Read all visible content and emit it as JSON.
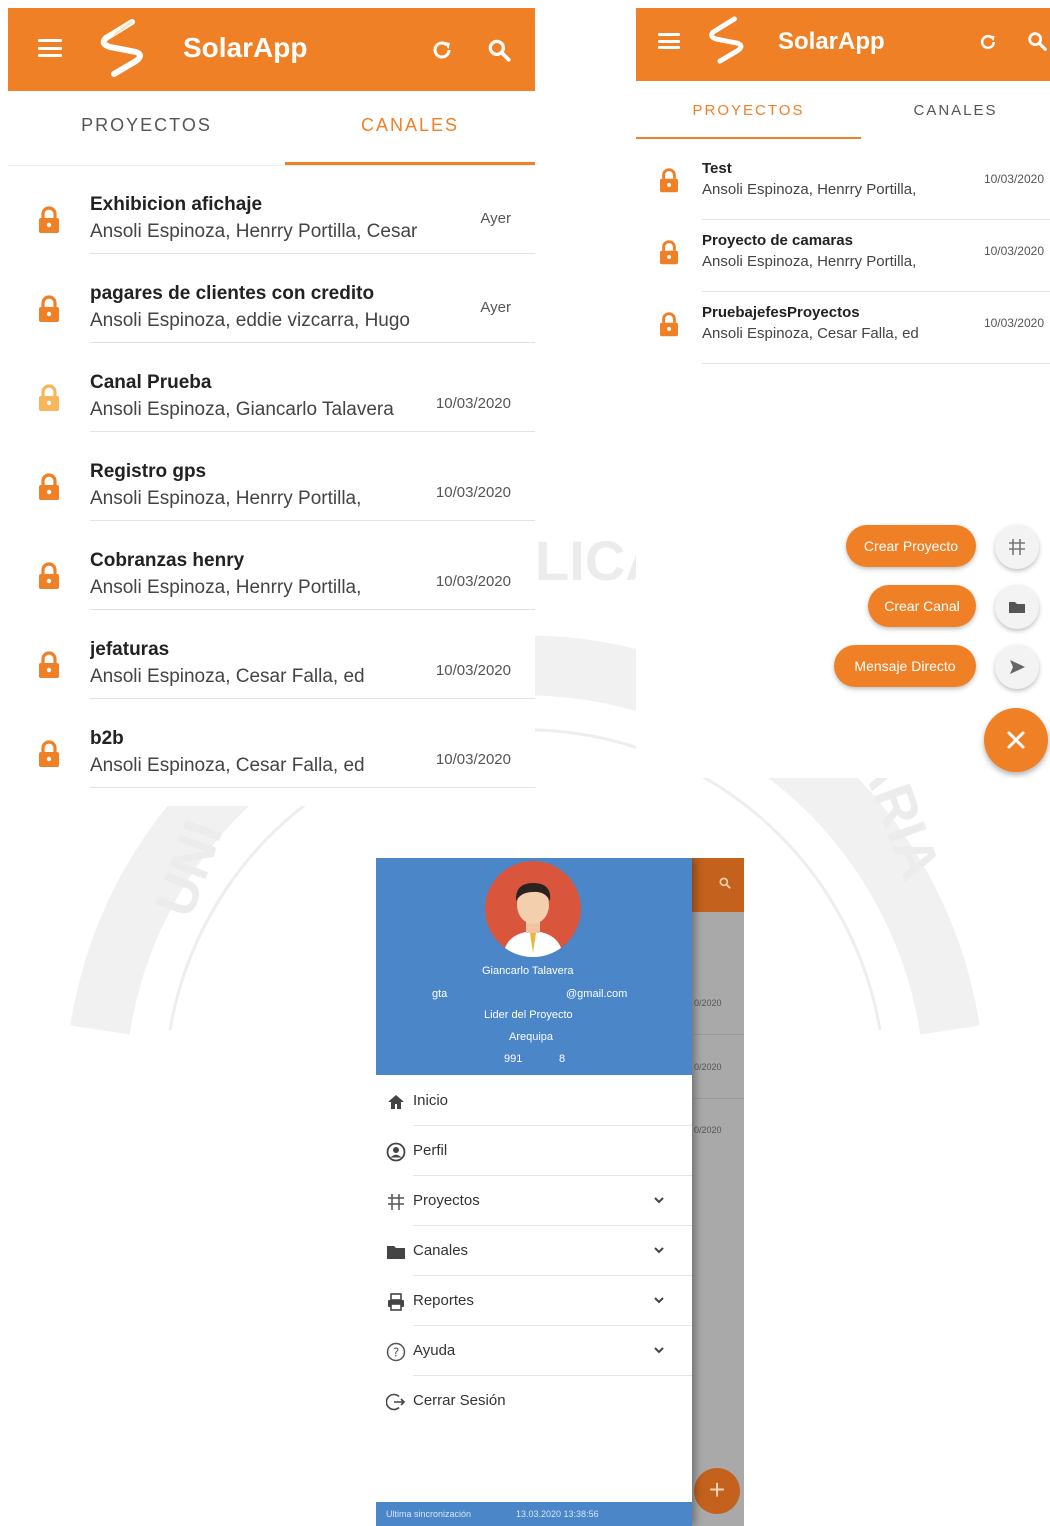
{
  "colors": {
    "primary": "#f08026",
    "lock": "#f08026",
    "lock_light": "#f7b65c",
    "drawer_header": "#4a86c8"
  },
  "app": {
    "title": "SolarApp"
  },
  "tabs": {
    "proyectos": "PROYECTOS",
    "canales": "CANALES"
  },
  "screen1": {
    "active_tab": "CANALES",
    "channels": [
      {
        "title": "Exhibicion afichaje",
        "subtitle": "Ansoli Espinoza, Henrry Portilla, Cesar",
        "date": "Ayer",
        "lock": "lock-icon"
      },
      {
        "title": "pagares de clientes con credito",
        "subtitle": "Ansoli Espinoza, eddie vizcarra, Hugo",
        "date": "Ayer",
        "lock": "lock-icon"
      },
      {
        "title": "Canal Prueba",
        "subtitle": "Ansoli Espinoza, Giancarlo Talavera",
        "date": "10/03/2020",
        "lock": "lock-open-icon"
      },
      {
        "title": "Registro gps",
        "subtitle": "Ansoli Espinoza, Henrry Portilla,",
        "date": "10/03/2020",
        "lock": "lock-icon"
      },
      {
        "title": "Cobranzas henry",
        "subtitle": "Ansoli Espinoza, Henrry Portilla,",
        "date": "10/03/2020",
        "lock": "lock-icon"
      },
      {
        "title": "jefaturas",
        "subtitle": "Ansoli Espinoza, Cesar Falla, ed",
        "date": "10/03/2020",
        "lock": "lock-icon"
      },
      {
        "title": "b2b",
        "subtitle": "Ansoli Espinoza, Cesar Falla, ed",
        "date": "10/03/2020",
        "lock": "lock-icon"
      }
    ]
  },
  "screen2": {
    "active_tab": "PROYECTOS",
    "projects": [
      {
        "title": "Test",
        "subtitle": "Ansoli Espinoza, Henrry Portilla,",
        "date": "10/03/2020"
      },
      {
        "title": "Proyecto de camaras",
        "subtitle": "Ansoli Espinoza, Henrry Portilla,",
        "date": "10/03/2020"
      },
      {
        "title": "PruebajefesProyectos",
        "subtitle": "Ansoli Espinoza, Cesar Falla, ed",
        "date": "10/03/2020"
      }
    ],
    "fab_actions": [
      {
        "label": "Crear Proyecto",
        "icon": "project-icon"
      },
      {
        "label": "Crear Canal",
        "icon": "folder-icon"
      },
      {
        "label": "Mensaje Directo",
        "icon": "send-icon"
      }
    ],
    "fab_close": "close-icon"
  },
  "drawer": {
    "user_name": "Giancarlo Talavera",
    "email_left": "gta",
    "email_right": "@gmail.com",
    "role": "Lider del Proyecto",
    "city": "Arequipa",
    "phone_left": "991",
    "phone_right": "8",
    "menu": [
      {
        "label": "Inicio",
        "icon": "home-icon",
        "expandable": false
      },
      {
        "label": "Perfil",
        "icon": "user-circle-icon",
        "expandable": false
      },
      {
        "label": "Proyectos",
        "icon": "project-icon",
        "expandable": true
      },
      {
        "label": "Canales",
        "icon": "folder-icon",
        "expandable": true
      },
      {
        "label": "Reportes",
        "icon": "printer-icon",
        "expandable": true
      },
      {
        "label": "Ayuda",
        "icon": "help-icon",
        "expandable": true
      },
      {
        "label": "Cerrar Sesión",
        "icon": "logout-icon",
        "expandable": false
      }
    ],
    "footer_label": "Ultima sincronización",
    "footer_value": "13.03.2020 13:38:56",
    "background_dates": [
      "0/2020",
      "0/2020",
      "0/2020"
    ],
    "background_fab": "+"
  }
}
